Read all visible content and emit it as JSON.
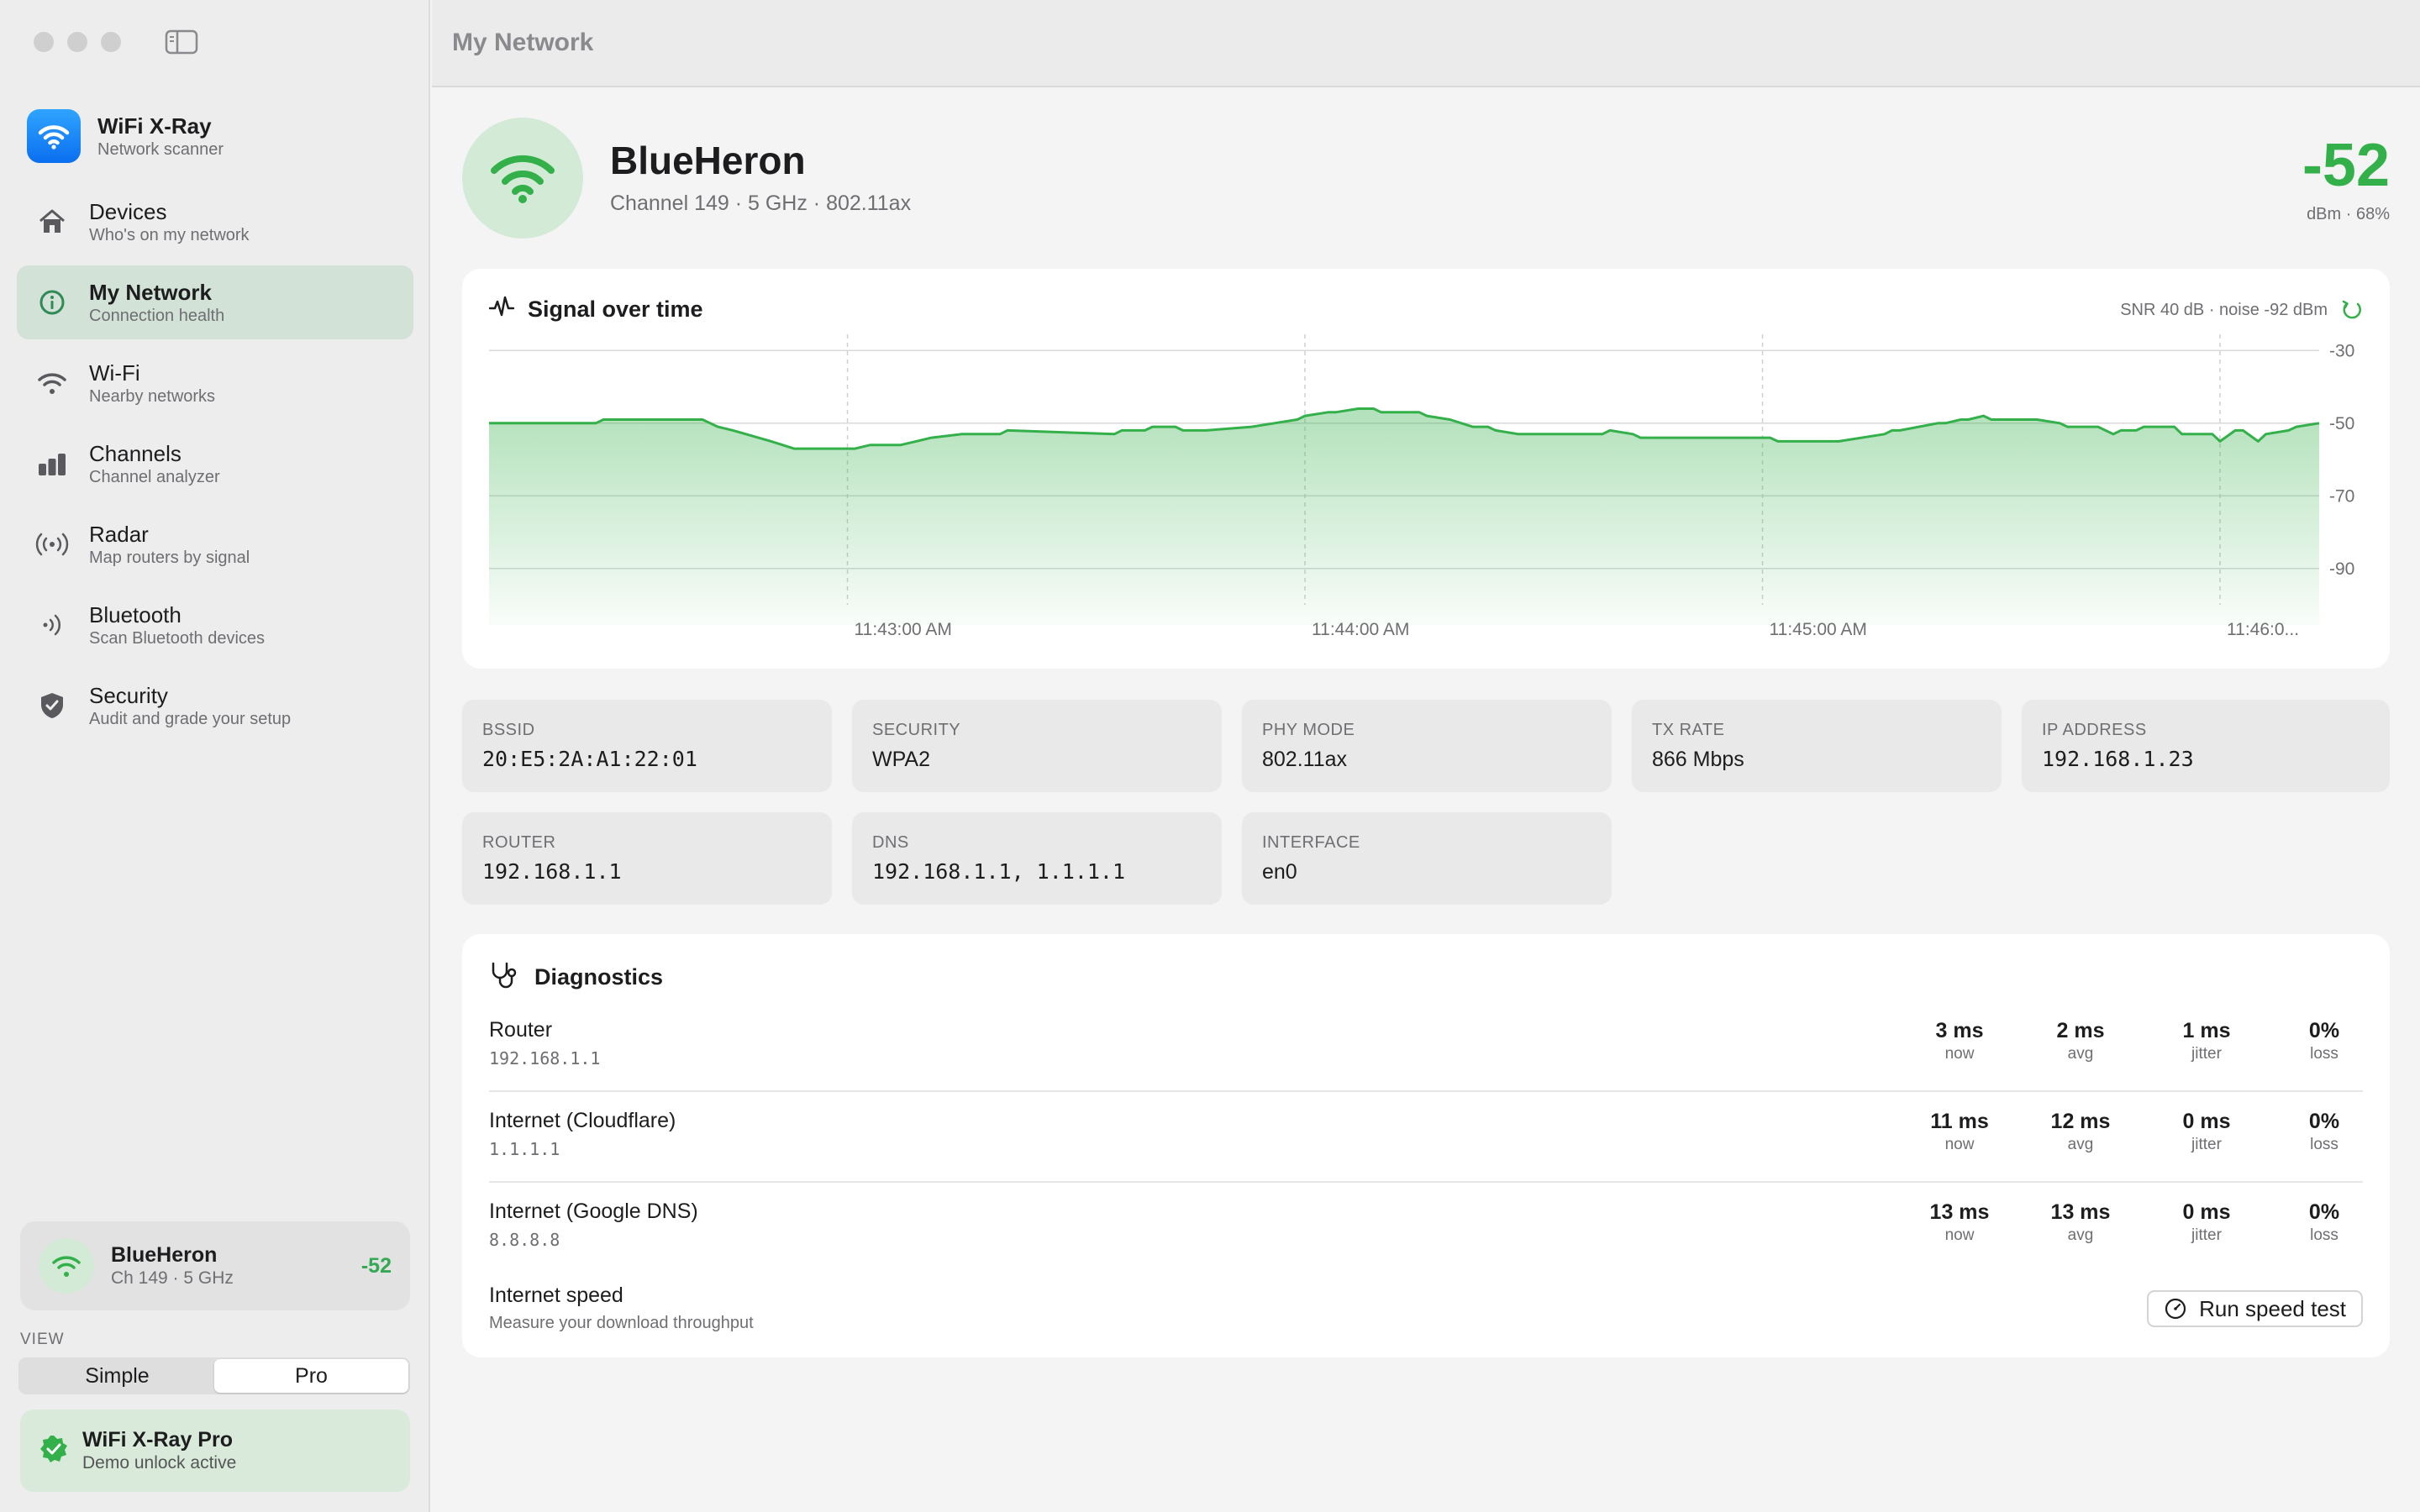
{
  "window": {
    "title": "My Network"
  },
  "app": {
    "name": "WiFi X-Ray",
    "subtitle": "Network scanner"
  },
  "sidebar": {
    "items": [
      {
        "label": "Devices",
        "sub": "Who's on my network",
        "icon": "house-icon"
      },
      {
        "label": "My Network",
        "sub": "Connection health",
        "icon": "info-circle-icon",
        "active": true
      },
      {
        "label": "Wi-Fi",
        "sub": "Nearby networks",
        "icon": "wifi-icon"
      },
      {
        "label": "Channels",
        "sub": "Channel analyzer",
        "icon": "bar-chart-icon"
      },
      {
        "label": "Radar",
        "sub": "Map routers by signal",
        "icon": "antenna-icon"
      },
      {
        "label": "Bluetooth",
        "sub": "Scan Bluetooth devices",
        "icon": "bluetooth-waves-icon"
      },
      {
        "label": "Security",
        "sub": "Audit and grade your setup",
        "icon": "shield-icon"
      }
    ],
    "current_network": {
      "name": "BlueHeron",
      "detail": "Ch 149 · 5 GHz",
      "rssi": "-52"
    },
    "view": {
      "label": "VIEW",
      "options": [
        "Simple",
        "Pro"
      ],
      "selected": "Pro"
    },
    "pro": {
      "title": "WiFi X-Ray Pro",
      "sub": "Demo unlock active"
    }
  },
  "hero": {
    "ssid": "BlueHeron",
    "detail": "Channel 149 · 5 GHz · 802.11ax",
    "rssi": "-52",
    "rssi_sub": "dBm · 68%"
  },
  "signal": {
    "title": "Signal over time",
    "meta": "SNR 40 dB · noise -92 dBm"
  },
  "chart_data": {
    "type": "area",
    "title": "Signal over time",
    "ylabel": "",
    "xlabel": "",
    "ylim": [
      -100,
      -26
    ],
    "yticks": [
      -30,
      -50,
      -70,
      -90
    ],
    "x_tick_labels": [
      "11:43:00 AM",
      "11:44:00 AM",
      "11:45:00 AM",
      "11:46:0..."
    ],
    "x_ticks_seconds": [
      60,
      120,
      180,
      240
    ],
    "x_range_seconds": [
      13,
      253
    ],
    "grid": true,
    "color": "#34b04a",
    "series": [
      {
        "x": [
          13,
          27,
          28,
          41,
          42,
          43,
          45,
          50,
          53,
          58,
          61,
          63,
          64,
          67,
          69,
          71,
          75,
          80,
          81,
          95,
          96,
          99,
          100,
          103,
          104,
          107,
          113,
          116,
          119,
          120,
          123,
          124,
          127,
          129,
          130,
          135,
          136,
          139,
          142,
          144,
          145,
          148,
          159,
          160,
          163,
          164,
          181,
          182,
          184,
          190,
          196,
          197,
          198,
          203,
          204,
          206,
          207,
          209,
          210,
          216,
          219,
          220,
          224,
          226,
          227,
          229,
          230,
          234,
          235,
          239,
          240,
          242,
          243,
          245,
          246,
          249,
          250,
          253
        ],
        "values": [
          -50,
          -50,
          -49,
          -49,
          -50,
          -51,
          -52,
          -55,
          -57,
          -57,
          -57,
          -56,
          -56,
          -56,
          -55,
          -54,
          -53,
          -53,
          -52,
          -53,
          -52,
          -52,
          -51,
          -51,
          -52,
          -52,
          -51,
          -50,
          -49,
          -48,
          -47,
          -47,
          -46,
          -46,
          -47,
          -47,
          -48,
          -49,
          -51,
          -51,
          -52,
          -53,
          -53,
          -52,
          -53,
          -54,
          -54,
          -55,
          -55,
          -55,
          -53,
          -52,
          -52,
          -50,
          -50,
          -49,
          -49,
          -48,
          -49,
          -49,
          -50,
          -51,
          -51,
          -53,
          -52,
          -52,
          -51,
          -51,
          -53,
          -53,
          -55,
          -52,
          -52,
          -55,
          -53,
          -52,
          -51,
          -50
        ]
      }
    ]
  },
  "info_tiles": [
    {
      "label": "BSSID",
      "value": "20:E5:2A:A1:22:01",
      "mono": true
    },
    {
      "label": "SECURITY",
      "value": "WPA2"
    },
    {
      "label": "PHY MODE",
      "value": "802.11ax"
    },
    {
      "label": "TX RATE",
      "value": "866 Mbps"
    },
    {
      "label": "IP ADDRESS",
      "value": "192.168.1.23",
      "mono": true
    },
    {
      "label": "ROUTER",
      "value": "192.168.1.1",
      "mono": true
    },
    {
      "label": "DNS",
      "value": "192.168.1.1, 1.1.1.1",
      "mono": true
    },
    {
      "label": "INTERFACE",
      "value": "en0"
    }
  ],
  "diagnostics": {
    "title": "Diagnostics",
    "stat_labels": [
      "now",
      "avg",
      "jitter",
      "loss"
    ],
    "rows": [
      {
        "name": "Router",
        "host": "192.168.1.1",
        "now": "3 ms",
        "avg": "2 ms",
        "jitter": "1 ms",
        "loss": "0%"
      },
      {
        "name": "Internet (Cloudflare)",
        "host": "1.1.1.1",
        "now": "11 ms",
        "avg": "12 ms",
        "jitter": "0 ms",
        "loss": "0%"
      },
      {
        "name": "Internet (Google DNS)",
        "host": "8.8.8.8",
        "now": "13 ms",
        "avg": "13 ms",
        "jitter": "0 ms",
        "loss": "0%"
      }
    ],
    "speed": {
      "title": "Internet speed",
      "sub": "Measure your download throughput",
      "button": "Run speed test"
    }
  },
  "colors": {
    "accent_green": "#34b04a",
    "active_nav_bg": "#d2e2d6",
    "brand_blue": "#0a84ff"
  }
}
